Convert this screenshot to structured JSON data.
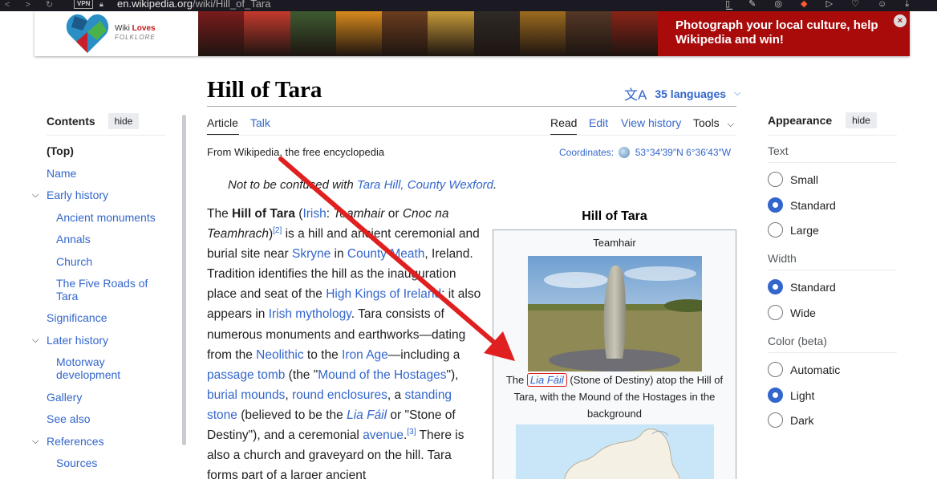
{
  "browser": {
    "nav_glyphs": "< > ↻",
    "vpn_label": "VPN",
    "url_domain": "en.wikipedia.org",
    "url_path": "/wiki/Hill_of_Tara"
  },
  "banner": {
    "logo_line1_a": "Wiki ",
    "logo_line1_b": "Loves",
    "logo_line2": "FOLKLORE",
    "cta": "Photograph your local culture, help Wikipedia and win!",
    "close_glyph": "×",
    "photo_colors": [
      "#7a1c1c",
      "#c43a2e",
      "#3e5b32",
      "#d78a1c",
      "#6b3d1f",
      "#c69a39",
      "#2f2a25",
      "#9c6b1f",
      "#553726",
      "#8a2418"
    ]
  },
  "toc": {
    "title": "Contents",
    "hide_label": "hide",
    "items": [
      {
        "label": "(Top)"
      },
      {
        "label": "Name"
      },
      {
        "label": "Early history"
      },
      {
        "label": "Ancient monuments"
      },
      {
        "label": "Annals"
      },
      {
        "label": "Church"
      },
      {
        "label": "The Five Roads of"
      },
      {
        "label": "Tara"
      },
      {
        "label": "Significance"
      },
      {
        "label": "Later history"
      },
      {
        "label": "Motorway"
      },
      {
        "label": "development"
      },
      {
        "label": "Gallery"
      },
      {
        "label": "See also"
      },
      {
        "label": "References"
      },
      {
        "label": "Sources"
      }
    ]
  },
  "article": {
    "title": "Hill of Tara",
    "languages": "35 languages",
    "tabs_left": [
      "Article",
      "Talk"
    ],
    "tabs_right": [
      "Read",
      "Edit",
      "View history",
      "Tools"
    ],
    "from": "From Wikipedia, the free encyclopedia",
    "coords_label": "Coordinates:",
    "coords_value": "53°34′39″N 6°36′43″W",
    "hatnote_prefix": "Not to be confused with ",
    "hatnote_link": "Tara Hill, County Wexford",
    "hatnote_suffix": "."
  },
  "infobox": {
    "title": "Hill of Tara",
    "subtitle": "Teamhair",
    "caption_prefix": "The ",
    "caption_link": "Lia Fáil",
    "caption_suffix": " (Stone of Destiny) atop the Hill of Tara, with the Mound of the Hostages in the background"
  },
  "appearance": {
    "title": "Appearance",
    "hide_label": "hide",
    "text_label": "Text",
    "text_options": [
      "Small",
      "Standard",
      "Large"
    ],
    "text_selected": "Standard",
    "width_label": "Width",
    "width_options": [
      "Standard",
      "Wide"
    ],
    "width_selected": "Standard",
    "color_label": "Color (beta)",
    "color_options": [
      "Automatic",
      "Light",
      "Dark"
    ],
    "color_selected": "Light"
  },
  "colors": {
    "link": "#3366cc",
    "accent": "#3366cc",
    "annotation_red": "#e02020",
    "banner_red": "#a90b0b"
  }
}
